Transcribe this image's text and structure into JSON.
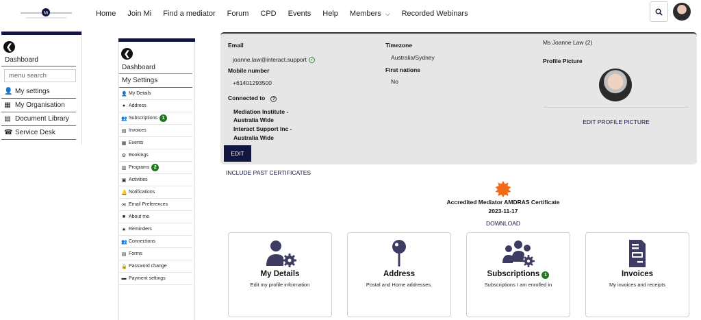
{
  "nav": {
    "items": [
      "Home",
      "Join Mi",
      "Find a mediator",
      "Forum",
      "CPD",
      "Events",
      "Help",
      "Members",
      "Recorded Webinars"
    ]
  },
  "left_panel": {
    "dashboard": "Dashboard",
    "search_placeholder": "menu search",
    "items": [
      "My settings",
      "My Organisation",
      "Document Library",
      "Service Desk"
    ]
  },
  "settings_panel": {
    "dashboard": "Dashboard",
    "my_settings": "My Settings",
    "items": [
      {
        "label": "My Details",
        "icon": "user-gear-icon"
      },
      {
        "label": "Address",
        "icon": "pin-icon"
      },
      {
        "label": "Subscriptions",
        "icon": "users-gear-icon",
        "badge": "1"
      },
      {
        "label": "Invoices",
        "icon": "invoice-icon"
      },
      {
        "label": "Events",
        "icon": "calendar-icon"
      },
      {
        "label": "Bookings",
        "icon": "booking-icon"
      },
      {
        "label": "Programs",
        "icon": "clipboard-icon",
        "badge": "2"
      },
      {
        "label": "Activities",
        "icon": "activity-icon"
      },
      {
        "label": "Notifications",
        "icon": "bell-icon"
      },
      {
        "label": "Email Preferences",
        "icon": "envelope-icon"
      },
      {
        "label": "About me",
        "icon": "about-icon"
      },
      {
        "label": "Reminders",
        "icon": "star-icon"
      },
      {
        "label": "Connections",
        "icon": "connections-icon"
      },
      {
        "label": "Forms",
        "icon": "form-icon"
      },
      {
        "label": "Password change",
        "icon": "lock-icon"
      },
      {
        "label": "Payment settings",
        "icon": "card-icon"
      }
    ]
  },
  "profile": {
    "email_label": "Email",
    "email": "joanne.law@interact.support",
    "mobile_label": "Mobile number",
    "mobile": "+61401293500",
    "connected_label": "Connected to",
    "connected": [
      "Mediation Institute -",
      "Australia Wide",
      "Interact Support Inc -",
      "Australia Wide"
    ],
    "timezone_label": "Timezone",
    "timezone": "Australia/Sydney",
    "first_nations_label": "First nations",
    "first_nations": "No",
    "name": "Ms Joanne Law (2)",
    "picture_label": "Profile Picture",
    "edit_picture": "EDIT PROFILE PICTURE",
    "edit_button": "EDIT"
  },
  "certificates": {
    "include_past": "INCLUDE PAST CERTIFICATES",
    "title": "Accredited Mediator AMDRAS Certificate",
    "date": "2023-11-17",
    "download": "DOWNLOAD"
  },
  "tiles": [
    {
      "title": "My Details",
      "desc": "Edit my profile information",
      "icon": "user-gear-icon"
    },
    {
      "title": "Address",
      "desc": "Postal and Home addresses.",
      "icon": "map-pin-icon"
    },
    {
      "title": "Subscriptions",
      "desc": "Subscriptions I am enrolled in",
      "icon": "users-gear-icon",
      "badge": "1"
    },
    {
      "title": "Invoices",
      "desc": "My invoices and receipts",
      "icon": "invoice-icon"
    }
  ],
  "colors": {
    "navy": "#10163f",
    "tile_icon": "#3e3c63",
    "badge": "#1f7a1f",
    "seal": "#f26b1d"
  }
}
